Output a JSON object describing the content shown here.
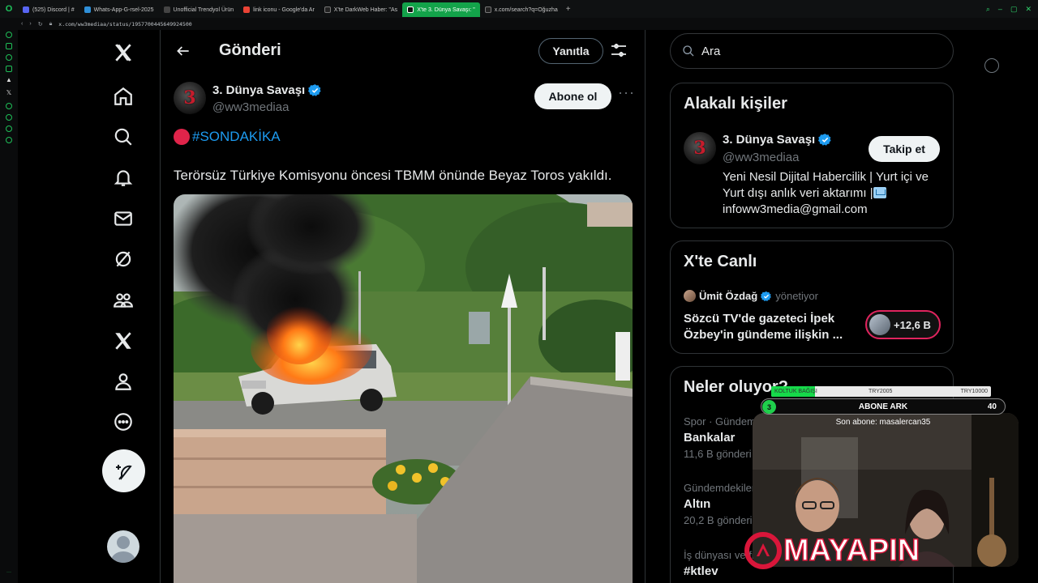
{
  "browser": {
    "tabs": [
      {
        "label": "(525) Discord | #",
        "color": "#5865f2",
        "active": false
      },
      {
        "label": "Whats-App-G-rsel-2025",
        "color": "#2f8fd8",
        "active": false
      },
      {
        "label": "Unofficial Trendyol Ürün",
        "color": "#333",
        "active": false
      },
      {
        "label": "link iconu - Google'da Ar",
        "color": "#ea4335",
        "active": false
      },
      {
        "label": "X'te DarkWeb Haber: \"As",
        "color": "#000",
        "active": false
      },
      {
        "label": "X'te 3. Dünya Savaşı: \"",
        "color": "#000",
        "active": true
      },
      {
        "label": "x.com/search?q=Oğuzha",
        "color": "#000",
        "active": false
      }
    ],
    "url": "x.com/ww3mediaa/status/1957700445649924500"
  },
  "nav": {
    "items": [
      "home-icon",
      "explore-icon",
      "notifications-icon",
      "messages-icon",
      "grok-icon",
      "communities-icon",
      "premium-icon",
      "profile-icon",
      "more-icon"
    ]
  },
  "header": {
    "title": "Gönderi",
    "reply_label": "Yanıtla"
  },
  "post": {
    "author_name": "3. Dünya Savaşı",
    "author_handle": "@ww3mediaa",
    "avatar_text": "3",
    "subscribe_label": "Abone ol",
    "more_label": "···",
    "hashtag": "#SONDAKİKA",
    "text": "Terörsüz Türkiye Komisyonu öncesi TBMM önünde Beyaz Toros yakıldı."
  },
  "search": {
    "placeholder": "Ara"
  },
  "related": {
    "title": "Alakalı kişiler",
    "name": "3. Dünya Savaşı",
    "handle": "@ww3mediaa",
    "follow_label": "Takip et",
    "bio_line1": "Yeni Nesil Dijital Habercilik | Yurt içi ve",
    "bio_line2": "Yurt dışı anlık veri aktarımı |",
    "bio_line3": "infoww3media@gmail.com"
  },
  "live": {
    "title": "X'te Canlı",
    "host": "Ümit Özdağ",
    "hosting_label": "yönetiyor",
    "space_title": "Sözcü TV'de gazeteci İpek Özbey'in gündeme ilişkin ...",
    "listeners": "+12,6 B"
  },
  "trends": {
    "title": "Neler oluyor?",
    "items": [
      {
        "meta": "Spor · Gündemde",
        "name": "Bankalar",
        "count": "11,6 B gönderi"
      },
      {
        "meta": "Gündemdekiler",
        "name": "Altın",
        "count": "20,2 B gönderi"
      },
      {
        "meta": "İş dünyası ve fi",
        "name": "#ktlev",
        "count": ""
      }
    ]
  },
  "overlay": {
    "donation_label": "KOLTUK BAĞIŞI",
    "donation_mid": "TRY2005",
    "donation_goal": "TRY10000",
    "donation_progress": 0.2,
    "sub_count": "3",
    "sub_title": "ABONE ARK",
    "sub_goal": "40",
    "last_sub": "Son abone: masalercan35",
    "logo_text": "MAYAPIN"
  },
  "colors": {
    "accent": "#1d9bf0",
    "live_ring": "#e0245e",
    "browser_active_tab": "#13a34a"
  }
}
